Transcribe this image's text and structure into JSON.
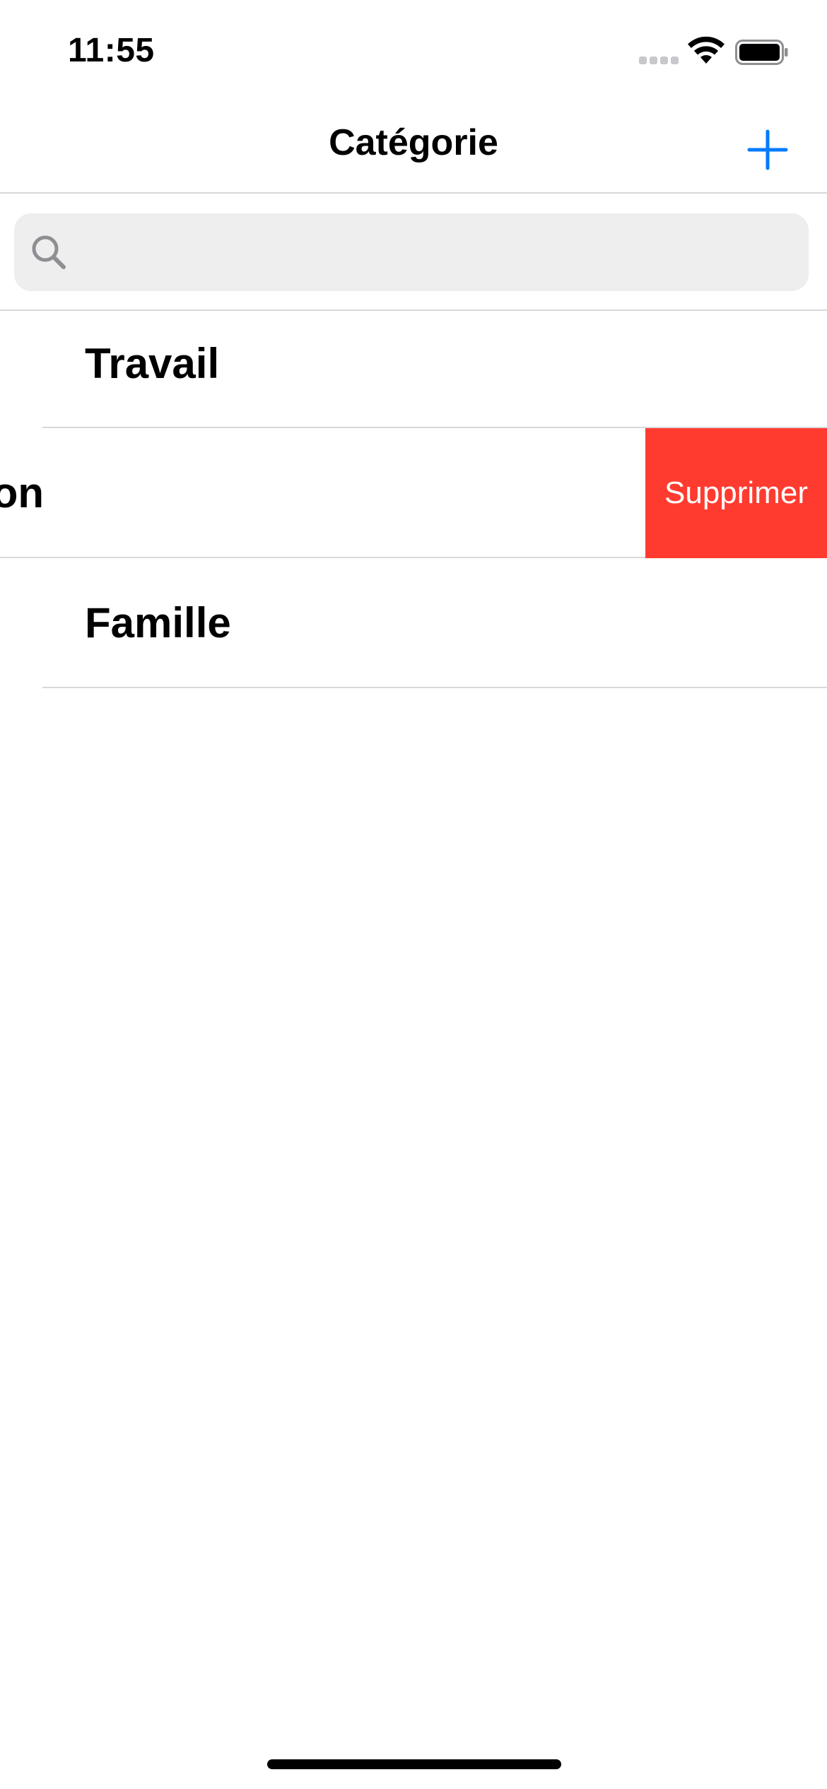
{
  "status_bar": {
    "time": "11:55"
  },
  "nav": {
    "title": "Catégorie",
    "add_icon": "plus-icon",
    "accent_color": "#007AFF"
  },
  "search": {
    "placeholder": "",
    "value": "",
    "icon": "search-icon"
  },
  "categories": [
    {
      "label": "Travail"
    },
    {
      "label": "on",
      "swiped": true,
      "action_label": "Supprimer",
      "action_color": "#FF3B30"
    },
    {
      "label": "Famille"
    }
  ]
}
